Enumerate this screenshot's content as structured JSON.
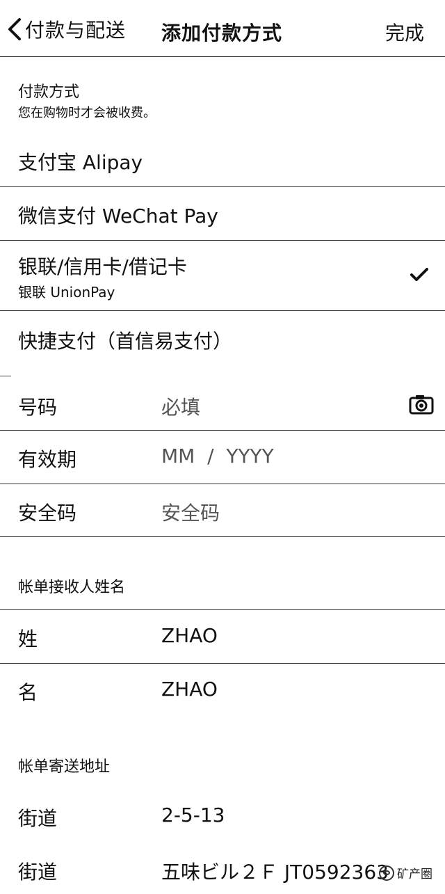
{
  "nav": {
    "back_label": "付款与配送",
    "title": "添加付款方式",
    "done_label": "完成"
  },
  "payment_section": {
    "title": "付款方式",
    "subtitle": "您在购物时才会被收费。",
    "options": [
      {
        "label": "支付宝 Alipay",
        "selected": false
      },
      {
        "label": "微信支付 WeChat Pay",
        "selected": false
      },
      {
        "label": "银联/信用卡/借记卡",
        "sublabel": "银联 UnionPay",
        "selected": true
      },
      {
        "label": "快捷支付（首信易支付）",
        "selected": false
      }
    ]
  },
  "card_fields": {
    "number_label": "号码",
    "number_placeholder": "必填",
    "expiry_label": "有效期",
    "expiry_placeholder": "MM  /  YYYY",
    "cvv_label": "安全码",
    "cvv_placeholder": "安全码"
  },
  "billing_name": {
    "title": "帐单接收人姓名",
    "last_name_label": "姓",
    "last_name_value": "ZHAO",
    "first_name_label": "名",
    "first_name_value": "ZHAO"
  },
  "billing_address": {
    "title": "帐单寄送地址",
    "street1_label": "街道",
    "street1_value": "2-5-13",
    "street2_label": "街道",
    "street2_value": "五味ビル２Ｆ JT0592363"
  },
  "watermark": "矿产圈",
  "icons": {
    "back": "chevron-left-icon",
    "check": "checkmark-icon",
    "camera": "camera-icon"
  }
}
